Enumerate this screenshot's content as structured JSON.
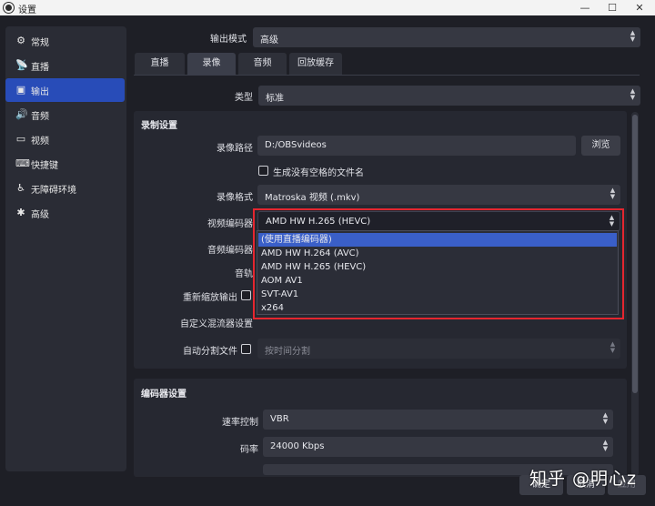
{
  "window": {
    "title": "设置",
    "minimize": "—",
    "maximize": "☐",
    "close": "✕"
  },
  "sidebar": {
    "items": [
      {
        "label": "常规",
        "icon": "gear-icon",
        "glyph": "⚙"
      },
      {
        "label": "直播",
        "icon": "broadcast-icon",
        "glyph": "📡"
      },
      {
        "label": "输出",
        "icon": "output-icon",
        "glyph": "▣"
      },
      {
        "label": "音频",
        "icon": "speaker-icon",
        "glyph": "🔊"
      },
      {
        "label": "视频",
        "icon": "monitor-icon",
        "glyph": "▭"
      },
      {
        "label": "快捷键",
        "icon": "keyboard-icon",
        "glyph": "⌨"
      },
      {
        "label": "无障碍环境",
        "icon": "accessibility-icon",
        "glyph": "♿"
      },
      {
        "label": "高级",
        "icon": "wrench-icon",
        "glyph": "✱"
      }
    ],
    "active_index": 2
  },
  "output_mode": {
    "label": "输出模式",
    "value": "高级"
  },
  "tabs": [
    {
      "label": "直播"
    },
    {
      "label": "录像"
    },
    {
      "label": "音频"
    },
    {
      "label": "回放缓存"
    }
  ],
  "active_tab": 1,
  "type": {
    "label": "类型",
    "value": "标准"
  },
  "recording": {
    "section_title": "录制设置",
    "path_label": "录像路径",
    "path_value": "D:/OBSvideos",
    "browse_label": "浏览",
    "no_space_label": "生成没有空格的文件名",
    "format_label": "录像格式",
    "format_value": "Matroska 视频 (.mkv)",
    "video_encoder_label": "视频编码器",
    "video_encoder_value": "AMD HW H.265 (HEVC)",
    "audio_encoder_label": "音频编码器",
    "audio_track_label": "音轨",
    "rescale_label": "重新缩放输出",
    "custom_muxer_label": "自定义混流器设置",
    "autosplit_label": "自动分割文件",
    "autosplit_value": "按时间分割"
  },
  "encoder_dropdown": {
    "options": [
      "(使用直播编码器)",
      "AMD HW H.264 (AVC)",
      "AMD HW H.265 (HEVC)",
      "AOM AV1",
      "SVT-AV1",
      "x264"
    ],
    "highlighted_index": 0
  },
  "encoder_settings": {
    "section_title": "编码器设置",
    "rate_control_label": "速率控制",
    "rate_control_value": "VBR",
    "bitrate_label": "码率",
    "bitrate_value": "24000 Kbps"
  },
  "footer": {
    "ok": "确定",
    "cancel": "取消",
    "apply": "应用"
  },
  "watermark": "知乎 @明心z",
  "colors": {
    "accent": "#284cb8",
    "highlight": "#3a5fc8",
    "annotation": "#e4262f",
    "background": "#1e1f26"
  }
}
